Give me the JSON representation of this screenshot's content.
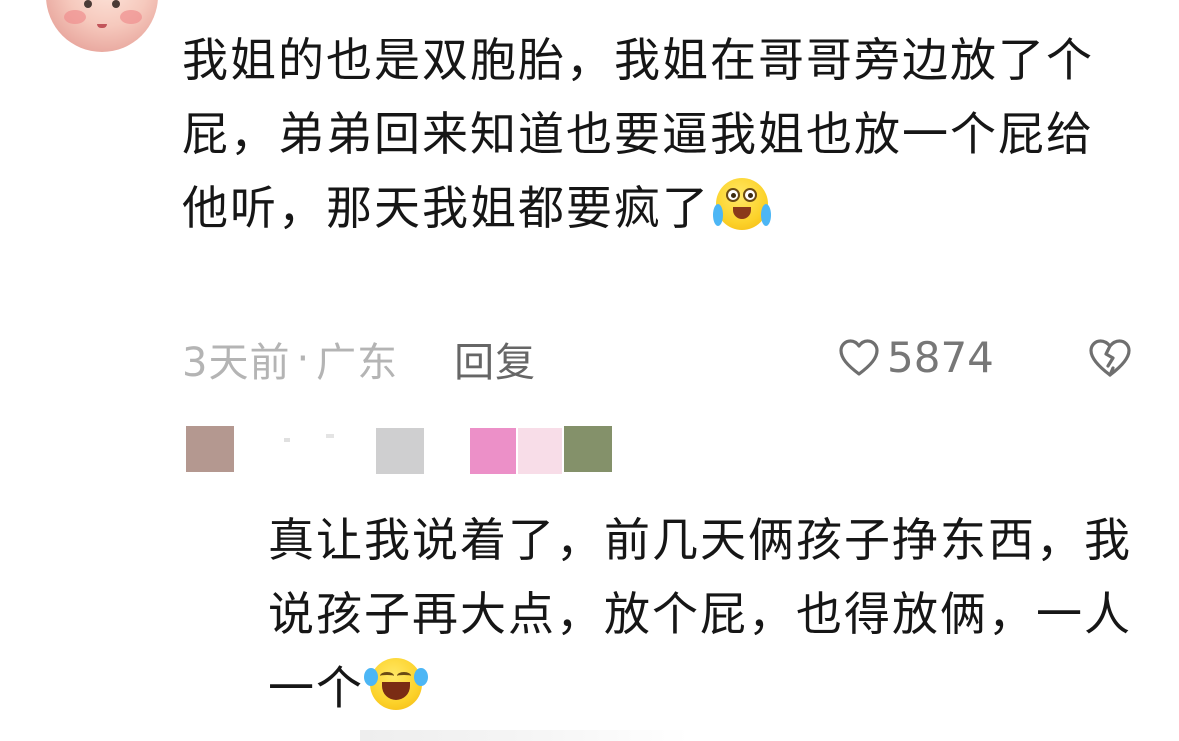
{
  "comment": {
    "text": "我姐的也是双胞胎，我姐在哥哥旁边放了个屁，弟弟回来知道也要逼我姐也放一个屁给他听，那天我姐都要疯了",
    "emoji": "crying-face-emoji",
    "time": "3天前",
    "dot": "·",
    "location": "广东",
    "reply_label": "回复",
    "like_count": "5874"
  },
  "reply": {
    "text": "真让我说着了，前几天俩孩子挣东西，我说孩子再大点，放个屁，也得放俩，一人一个",
    "emoji": "laughing-crying-emoji"
  },
  "colors": {
    "text": "#161616",
    "meta": "#b4b4b4",
    "reply_button": "#666666",
    "like_count": "#777777"
  }
}
